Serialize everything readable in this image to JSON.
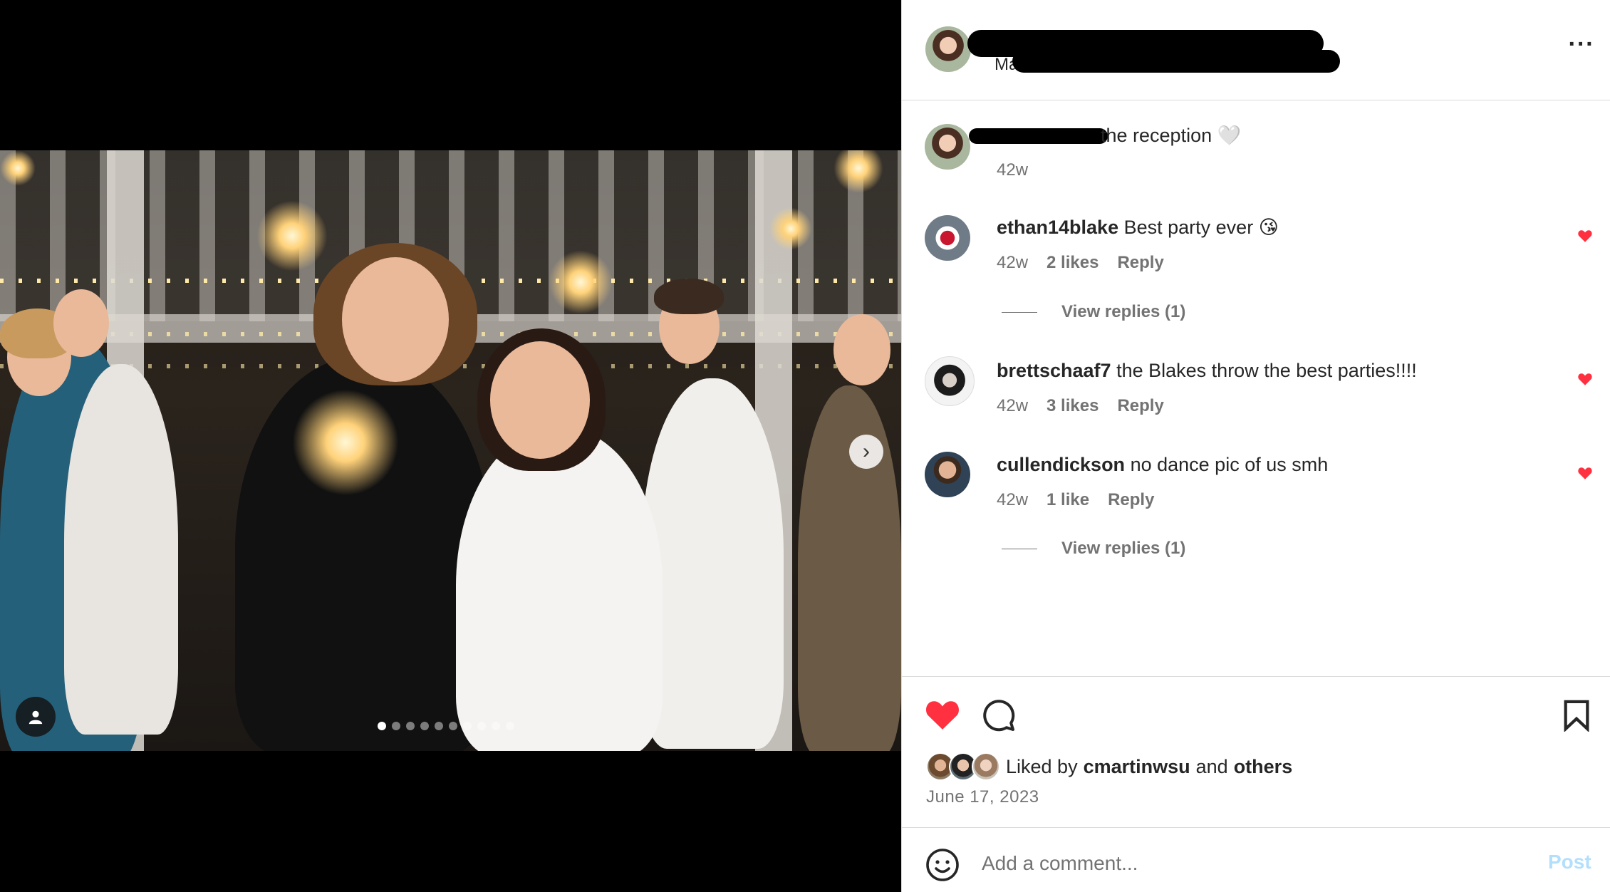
{
  "header": {
    "username_visible_prefix": "Ma",
    "more_icon": "more-horizontal-icon"
  },
  "caption": {
    "text_visible": "the reception 🤍",
    "time": "42w"
  },
  "comments": [
    {
      "username": "ethan14blake",
      "text": "Best party ever 😘",
      "time": "42w",
      "likes": "2 likes",
      "reply_label": "Reply",
      "view_replies": "View replies (1)",
      "liked": true
    },
    {
      "username": "brettschaaf7",
      "text": "the Blakes throw the best parties!!!!",
      "time": "42w",
      "likes": "3 likes",
      "reply_label": "Reply",
      "liked": true
    },
    {
      "username": "cullendickson",
      "text": "no dance pic of us smh",
      "time": "42w",
      "likes": "1 like",
      "reply_label": "Reply",
      "view_replies": "View replies (1)",
      "liked": true
    }
  ],
  "actions": {
    "like_icon": "heart-filled-icon",
    "comment_icon": "comment-icon",
    "save_icon": "bookmark-icon",
    "liked_prefix": "Liked by",
    "liked_user": "cmartinwsu",
    "liked_and": "and",
    "liked_others": "others",
    "date": "June 17, 2023"
  },
  "add_comment": {
    "placeholder": "Add a comment...",
    "post_label": "Post",
    "emoji_icon": "smiley-icon"
  },
  "media": {
    "carousel_total": 10,
    "carousel_active": 1,
    "next_icon": "chevron-right-icon",
    "tag_icon": "user-tag-icon"
  },
  "colors": {
    "like_red": "#ff3040",
    "post_disabled_blue": "#b2dffc",
    "secondary_text": "#737373",
    "divider": "#dbdbdb"
  }
}
